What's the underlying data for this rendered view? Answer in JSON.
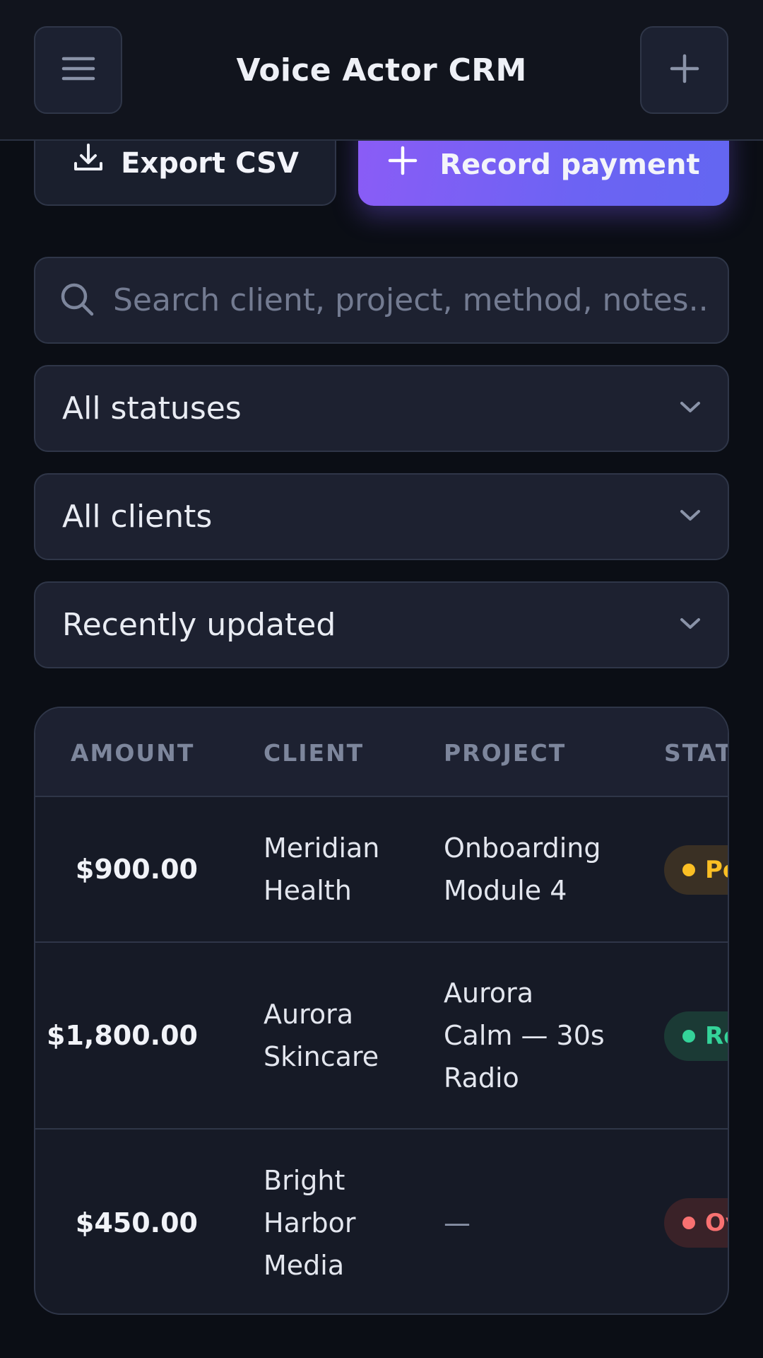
{
  "header": {
    "title": "Voice Actor CRM",
    "menu_icon": "hamburger-menu-icon",
    "add_icon": "plus-icon"
  },
  "actions": {
    "export_label": "Export CSV",
    "export_icon": "download-icon",
    "record_label": "Record payment",
    "record_icon": "plus-icon"
  },
  "search": {
    "placeholder": "Search client, project, method, notes..",
    "value": "",
    "icon": "search-icon"
  },
  "filters": {
    "status": "All statuses",
    "client": "All clients",
    "sort": "Recently updated"
  },
  "table": {
    "columns": [
      "AMOUNT",
      "CLIENT",
      "PROJECT",
      "STATUS"
    ],
    "rows": [
      {
        "amount": "$900.00",
        "client": [
          "Meridian",
          "Health"
        ],
        "project": [
          "Onboarding",
          "Module 4"
        ],
        "status": "Pending",
        "status_color": "#fbbf24"
      },
      {
        "amount": "$1,800.00",
        "client": [
          "Aurora",
          "Skincare"
        ],
        "project": [
          "Aurora",
          "Calm — 30s",
          "Radio"
        ],
        "status": "Received",
        "status_color": "#34d399"
      },
      {
        "amount": "$450.00",
        "client": [
          "Bright",
          "Harbor",
          "Media"
        ],
        "project": [
          "—"
        ],
        "status": "Overdue",
        "status_color": "#f87171"
      }
    ]
  },
  "colors": {
    "accent_start": "#8b5cf6",
    "accent_end": "#6366f1",
    "background": "#0b0e15"
  }
}
